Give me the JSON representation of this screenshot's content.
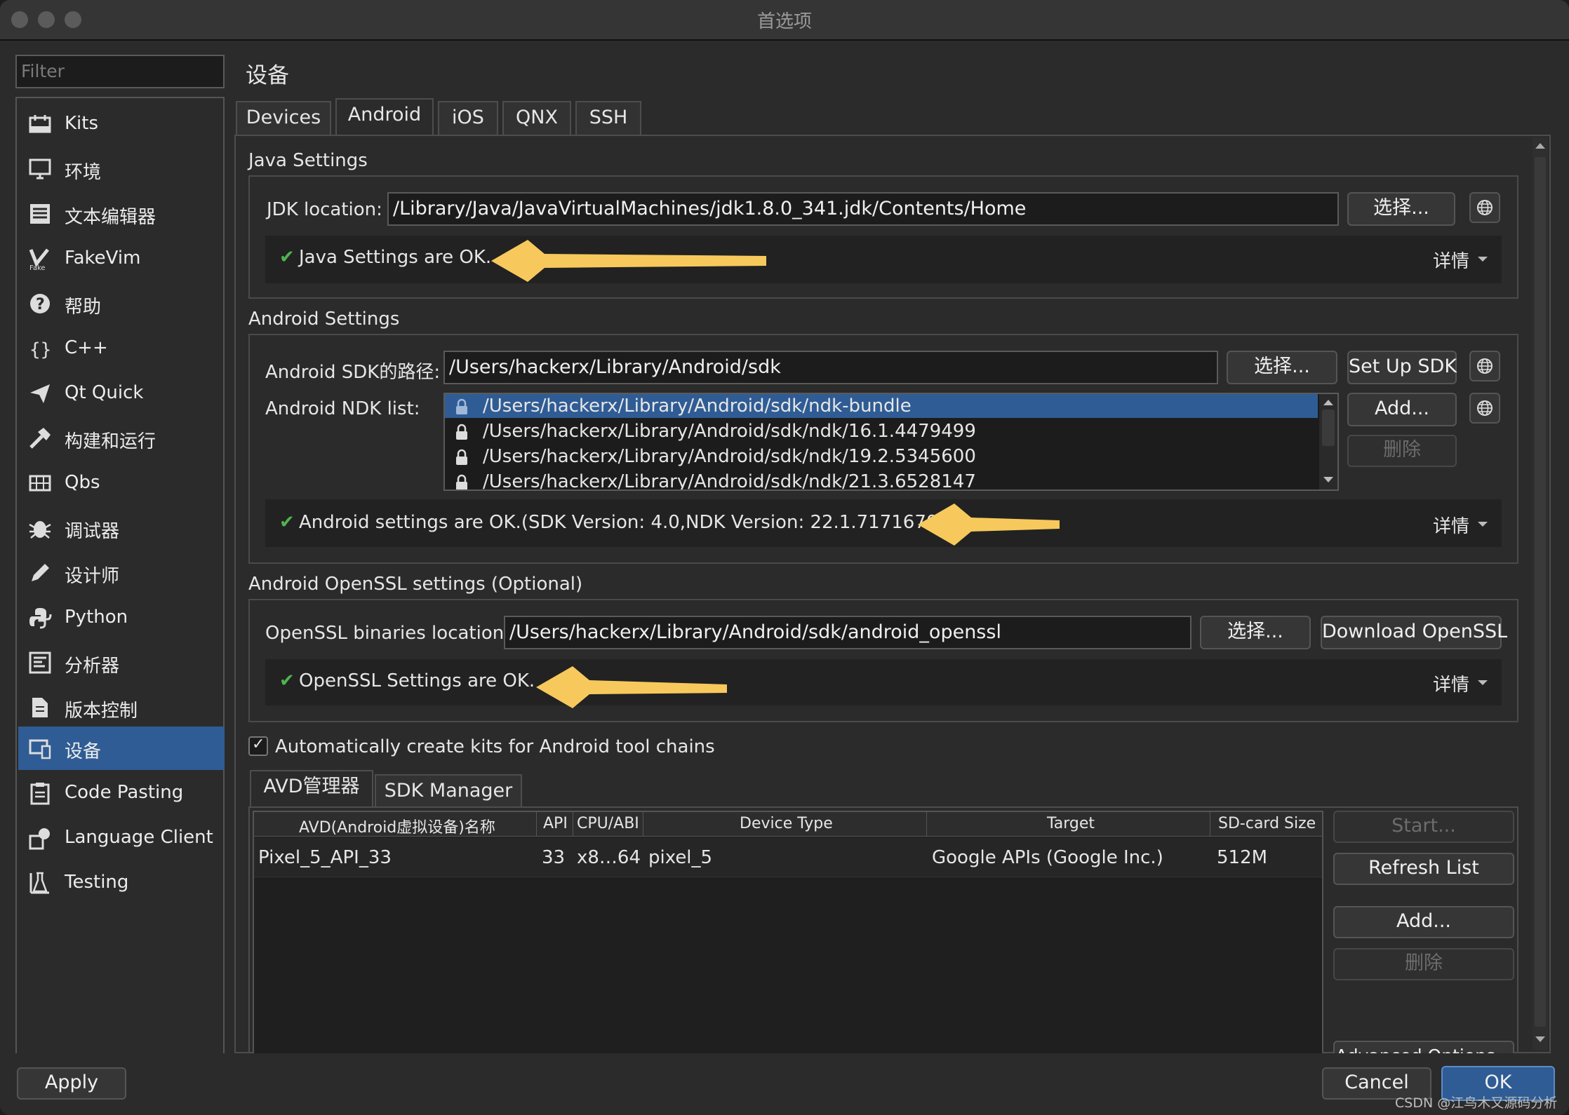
{
  "window": {
    "title": "首选项"
  },
  "filter": {
    "placeholder": "Filter"
  },
  "sidebar": {
    "items": [
      {
        "label": "Kits",
        "icon": "kits-icon"
      },
      {
        "label": "环境",
        "icon": "monitor-icon"
      },
      {
        "label": "文本编辑器",
        "icon": "text-editor-icon"
      },
      {
        "label": "FakeVim",
        "icon": "fakevim-icon"
      },
      {
        "label": "帮助",
        "icon": "help-icon"
      },
      {
        "label": "C++",
        "icon": "braces-icon"
      },
      {
        "label": "Qt Quick",
        "icon": "paper-plane-icon"
      },
      {
        "label": "构建和运行",
        "icon": "hammer-icon"
      },
      {
        "label": "Qbs",
        "icon": "grid-icon"
      },
      {
        "label": "调试器",
        "icon": "bug-icon"
      },
      {
        "label": "设计师",
        "icon": "pencil-icon"
      },
      {
        "label": "Python",
        "icon": "python-icon"
      },
      {
        "label": "分析器",
        "icon": "analyzer-icon"
      },
      {
        "label": "版本控制",
        "icon": "version-control-icon"
      },
      {
        "label": "设备",
        "icon": "device-icon",
        "selected": true
      },
      {
        "label": "Code Pasting",
        "icon": "clipboard-icon"
      },
      {
        "label": "Language Client",
        "icon": "language-client-icon"
      },
      {
        "label": "Testing",
        "icon": "testing-icon"
      }
    ]
  },
  "page": {
    "heading": "设备"
  },
  "tabs": [
    "Devices",
    "Android",
    "iOS",
    "QNX",
    "SSH"
  ],
  "java": {
    "section_title": "Java Settings",
    "jdk_label": "JDK location:",
    "jdk_path": "/Library/Java/JavaVirtualMachines/jdk1.8.0_341.jdk/Contents/Home",
    "choose": "选择...",
    "status": "Java Settings are OK.",
    "details": "详情"
  },
  "android": {
    "section_title": "Android Settings",
    "sdk_label": "Android SDK的路径:",
    "sdk_path": "/Users/hackerx/Library/Android/sdk",
    "choose": "选择...",
    "setup_sdk": "Set Up SDK",
    "ndk_label": "Android NDK list:",
    "ndk_list": [
      "/Users/hackerx/Library/Android/sdk/ndk-bundle",
      "/Users/hackerx/Library/Android/sdk/ndk/16.1.4479499",
      "/Users/hackerx/Library/Android/sdk/ndk/19.2.5345600",
      "/Users/hackerx/Library/Android/sdk/ndk/21.3.6528147"
    ],
    "add": "Add...",
    "remove": "删除",
    "status": "Android settings are OK.(SDK Version: 4.0,NDK Version: 22.1.7171670)",
    "details": "详情"
  },
  "openssl": {
    "section_title": "Android OpenSSL settings (Optional)",
    "label": "OpenSSL binaries location:",
    "path": "/Users/hackerx/Library/Android/sdk/android_openssl",
    "choose": "选择...",
    "download": "Download OpenSSL",
    "status": "OpenSSL Settings are OK.",
    "details": "详情"
  },
  "auto_kits": {
    "label": "Automatically create kits for Android tool chains",
    "checked": true
  },
  "avd_tabs": [
    "AVD管理器",
    "SDK Manager"
  ],
  "avd_table": {
    "columns": [
      "AVD(Android虚拟设备)名称",
      "API",
      "CPU/ABI",
      "Device Type",
      "Target",
      "SD-card Size"
    ],
    "rows": [
      [
        "Pixel_5_API_33",
        "33",
        "x8…64",
        "pixel_5",
        "Google APIs (Google Inc.)",
        "512M"
      ]
    ]
  },
  "avd_buttons": {
    "start": "Start...",
    "refresh": "Refresh List",
    "add": "Add...",
    "remove": "删除",
    "advanced": "Advanced Options..."
  },
  "footer": {
    "apply": "Apply",
    "cancel": "Cancel",
    "ok": "OK"
  },
  "watermark": "CSDN @江鸟木又源码分析",
  "colors": {
    "selection": "#2f5c94",
    "ok_check": "#4fb34f",
    "arrow": "#f7c95c",
    "background": "#2b2b2b"
  }
}
